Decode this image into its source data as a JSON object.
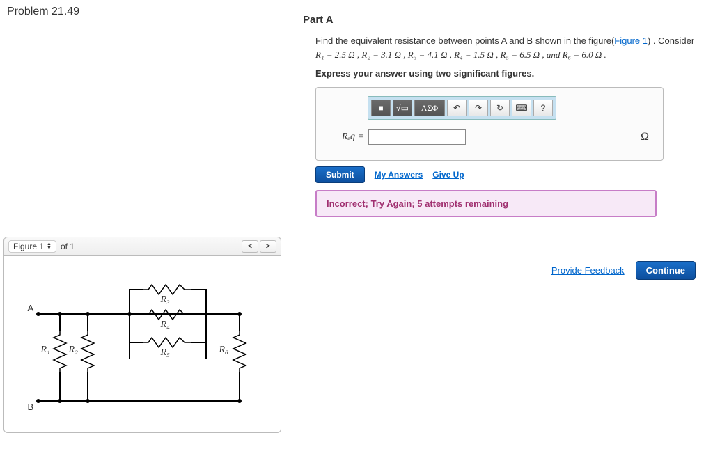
{
  "problem": {
    "title": "Problem 21.49"
  },
  "figure": {
    "label": "Figure 1",
    "of": "of 1"
  },
  "circuit": {
    "nodeA": "A",
    "nodeB": "B",
    "r1": "R₁",
    "r2": "R₂",
    "r3": "R₃",
    "r4": "R₄",
    "r5": "R₅",
    "r6": "R₆"
  },
  "partA": {
    "heading": "Part A",
    "question_pre": "Find the equivalent resistance between points A and B shown in the figure(",
    "figure_link": "Figure 1",
    "question_post": ") . Consider ",
    "values_html": "R₁ = 2.5 Ω , R₂ = 3.1 Ω , R₃ = 4.1 Ω , R₄ = 1.5 Ω , R₅ = 6.5 Ω , and R₆ = 6.0 Ω .",
    "instruction": "Express your answer using two significant figures.",
    "toolbar": {
      "template": "■",
      "fraction": "√▭",
      "greek": "ΑΣΦ",
      "undo": "↶",
      "redo": "↷",
      "reset": "↻",
      "keyboard": "⌨",
      "help": "?"
    },
    "answer_label": "Rₑq =",
    "answer_value": "",
    "unit": "Ω",
    "submit": "Submit",
    "my_answers": "My Answers",
    "give_up": "Give Up",
    "feedback": "Incorrect; Try Again; 5 attempts remaining"
  },
  "footer": {
    "provide_feedback": "Provide Feedback",
    "continue": "Continue"
  },
  "resistor_values": {
    "R1": 2.5,
    "R2": 3.1,
    "R3": 4.1,
    "R4": 1.5,
    "R5": 6.5,
    "R6": 6.0,
    "unit": "Ω"
  }
}
